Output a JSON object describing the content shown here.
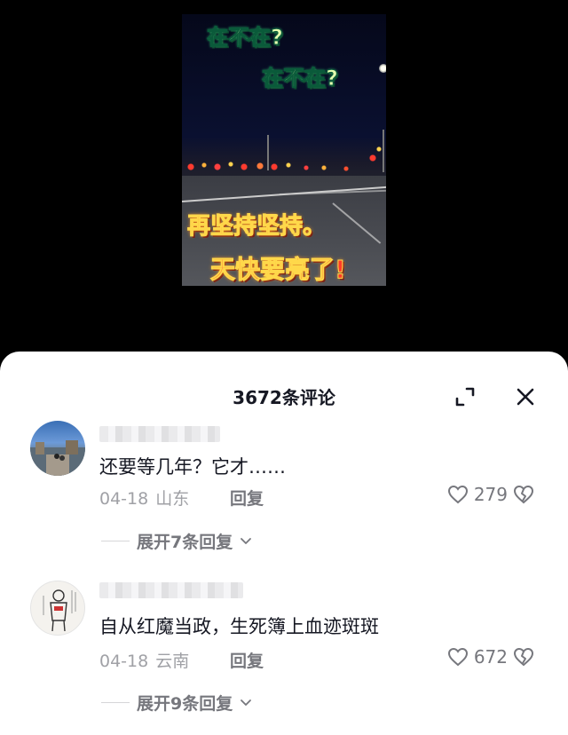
{
  "video": {
    "overlay_line_1": "在不在?",
    "overlay_line_2": "在不在?",
    "overlay_line_3": "再坚持坚持。",
    "overlay_line_4": "天快要亮了!"
  },
  "sheet": {
    "title": "3672条评论",
    "expand_icon": "expand-icon",
    "close_icon": "close-icon"
  },
  "comments": [
    {
      "text": "还要等几年？它才……",
      "date": "04-18",
      "location": "山东",
      "reply_label": "回复",
      "likes": "279",
      "expand_label": "展开7条回复"
    },
    {
      "text": "自从红魔当政，生死簿上血迹斑斑",
      "date": "04-18",
      "location": "云南",
      "reply_label": "回复",
      "likes": "672",
      "expand_label": "展开9条回复"
    }
  ],
  "colors": {
    "background": "#000000",
    "sheet": "#ffffff",
    "text_primary": "#161823",
    "text_secondary": "#a0a1a6"
  }
}
